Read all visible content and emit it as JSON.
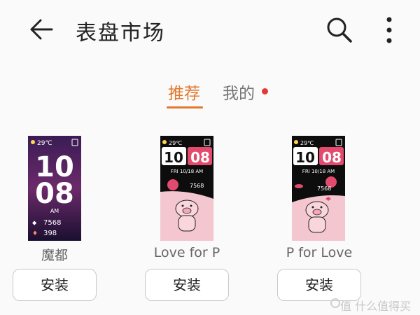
{
  "header": {
    "title": "表盘市场",
    "back_icon": "arrow-left-icon",
    "search_icon": "search-icon",
    "more_icon": "more-vertical-icon"
  },
  "tabs": [
    {
      "label": "推荐",
      "active": true
    },
    {
      "label": "我的",
      "active": false,
      "badge": true
    }
  ],
  "accent_color": "#e2792e",
  "badge_color": "#e53935",
  "faces": [
    {
      "name": "魔都",
      "install_label": "安装",
      "status": {
        "temp": "29℃"
      },
      "time_hour": "10",
      "time_min": "08",
      "ampm": "AM",
      "steps": "7568",
      "calories": "398"
    },
    {
      "name": "Love for P",
      "install_label": "安装",
      "status": {
        "temp": "29℃"
      },
      "time_hour": "10",
      "time_min": "08",
      "date": "FRI 10/18 AM",
      "steps": "7568"
    },
    {
      "name": "P for Love",
      "install_label": "安装",
      "status": {
        "temp": "29℃"
      },
      "time_hour": "10",
      "time_min": "08",
      "date": "FRI 10/18 AM",
      "steps": "7568"
    }
  ],
  "watermark": "值 什么值得买"
}
